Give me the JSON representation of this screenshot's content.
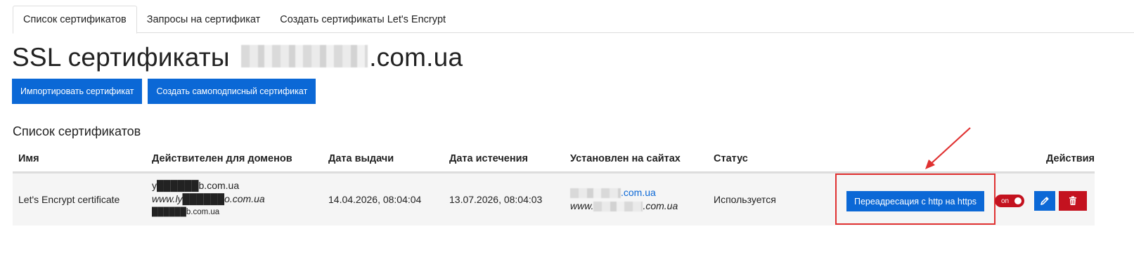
{
  "tabs": [
    {
      "label": "Список сертификатов",
      "active": true
    },
    {
      "label": "Запросы на сертификат",
      "active": false
    },
    {
      "label": "Создать сертификаты Let's Encrypt",
      "active": false
    }
  ],
  "page": {
    "title_prefix": "SSL сертификаты",
    "title_suffix": ".com.ua"
  },
  "buttons": {
    "import": "Импортировать сертификат",
    "self_signed": "Создать самоподписный сертификат"
  },
  "section_title": "Список сертификатов",
  "table": {
    "headers": [
      "Имя",
      "Действителен для доменов",
      "Дата выдачи",
      "Дата истечения",
      "Установлен на сайтах",
      "Статус",
      "Действия"
    ],
    "rows": [
      {
        "name": "Let's Encrypt certificate",
        "domains": [
          "y██████b.com.ua",
          "www.ly██████o.com.ua",
          "██████b.com.ua"
        ],
        "issued": "14.04.2026, 08:04:04",
        "expires": "13.07.2026, 08:04:03",
        "sites": [
          ".com.ua",
          "www.",
          ".com.ua"
        ],
        "status": "Используется",
        "redirect_label": "Переадресация с http на https",
        "toggle_label": "on"
      }
    ]
  },
  "colors": {
    "primary": "#0b68d6",
    "danger": "#c4121f",
    "annotation": "#e03131"
  },
  "icons": {
    "edit": "pencil-icon",
    "delete": "trash-icon"
  }
}
